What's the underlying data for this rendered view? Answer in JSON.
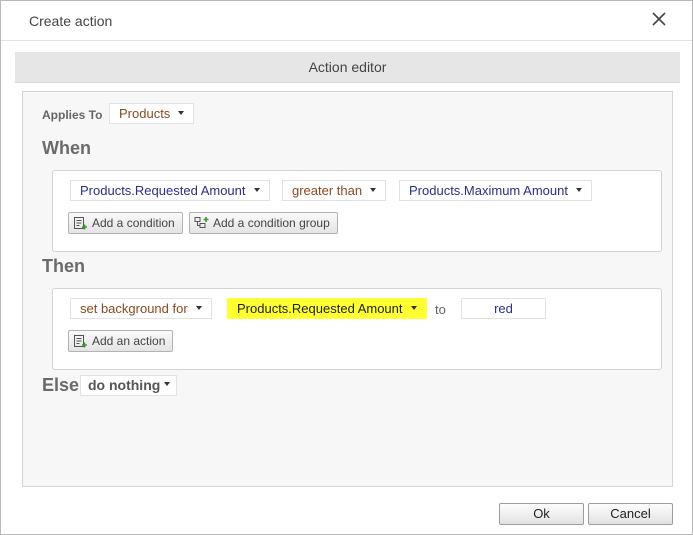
{
  "dialog": {
    "title": "Create action",
    "close_icon": "close-icon"
  },
  "editor": {
    "header": "Action editor",
    "applies_to": {
      "label": "Applies To",
      "value": "Products"
    },
    "when": {
      "label": "When",
      "condition": {
        "field": "Products.Requested Amount",
        "operator": "greater than",
        "value": "Products.Maximum Amount"
      },
      "add_condition_label": "Add a condition",
      "add_condition_group_label": "Add a condition group"
    },
    "then": {
      "label": "Then",
      "action": {
        "verb": "set background for",
        "target": "Products.Requested Amount",
        "to_label": "to",
        "value": "red"
      },
      "add_action_label": "Add an action"
    },
    "else": {
      "label": "Else",
      "value": "do nothing"
    }
  },
  "footer": {
    "ok_label": "Ok",
    "cancel_label": "Cancel"
  },
  "colors": {
    "highlight": "#ffff33",
    "field_text": "#2a2f8a",
    "operator_text": "#8a4a22"
  }
}
